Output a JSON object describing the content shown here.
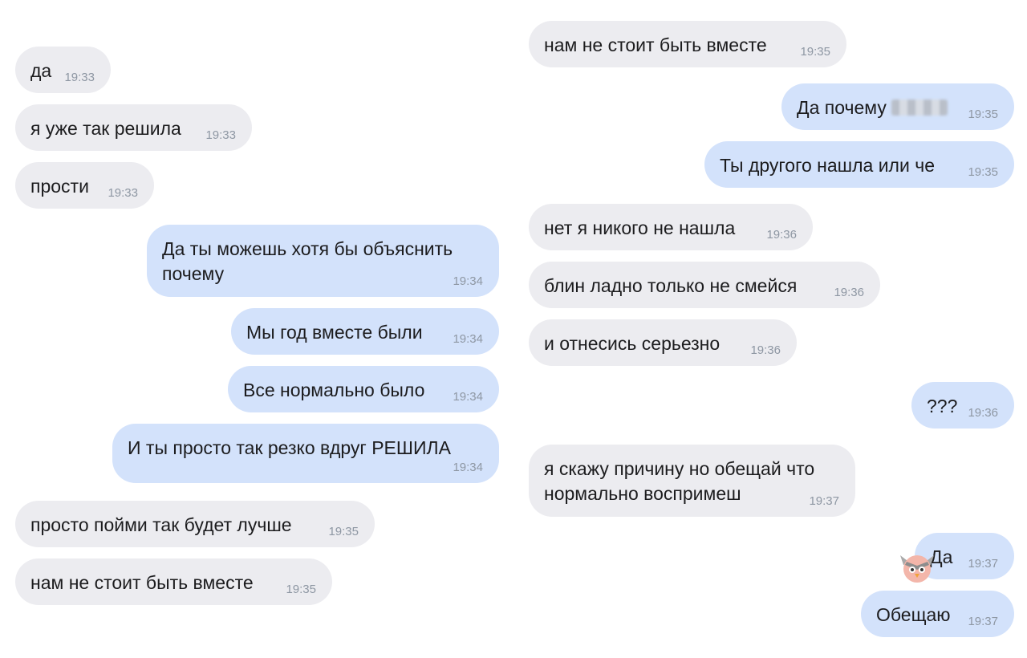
{
  "colors": {
    "incoming_bubble": "#ececf0",
    "outgoing_bubble": "#d3e2fb",
    "time_text": "#8e97a3"
  },
  "left_column": [
    {
      "text": "да",
      "time": "19:33",
      "direction": "in"
    },
    {
      "text": "я уже так решила",
      "time": "19:33",
      "direction": "in"
    },
    {
      "text": "прости",
      "time": "19:33",
      "direction": "in"
    },
    {
      "text": "Да ты можешь хотя бы объяснить почему",
      "time": "19:34",
      "direction": "out"
    },
    {
      "text": "Мы год вместе были",
      "time": "19:34",
      "direction": "out"
    },
    {
      "text": "Все нормально было",
      "time": "19:34",
      "direction": "out"
    },
    {
      "text": "И ты просто так резко вдруг РЕШИЛА",
      "time": "19:34",
      "direction": "out"
    },
    {
      "text": "просто пойми так будет лучше",
      "time": "19:35",
      "direction": "in"
    },
    {
      "text": "нам не стоит быть вместе",
      "time": "19:35",
      "direction": "in"
    }
  ],
  "right_column": [
    {
      "text": "нам не стоит быть вместе",
      "time": "19:35",
      "direction": "in"
    },
    {
      "text": "Да почему",
      "time": "19:35",
      "direction": "out",
      "redacted_name": true
    },
    {
      "text": "Ты другого нашла или че",
      "time": "19:35",
      "direction": "out"
    },
    {
      "text": "нет я никого не нашла",
      "time": "19:36",
      "direction": "in"
    },
    {
      "text": "блин ладно только не смейся",
      "time": "19:36",
      "direction": "in"
    },
    {
      "text": "и отнесись серьезно",
      "time": "19:36",
      "direction": "in"
    },
    {
      "text": "???",
      "time": "19:36",
      "direction": "out"
    },
    {
      "text": "я скажу причину но обещай что нормально воспримеш",
      "time": "19:37",
      "direction": "in"
    },
    {
      "text": "Да",
      "time": "19:37",
      "direction": "out"
    },
    {
      "text": "Обещаю",
      "time": "19:37",
      "direction": "out"
    }
  ],
  "watermark": {
    "icon": "owl-logo-icon"
  }
}
